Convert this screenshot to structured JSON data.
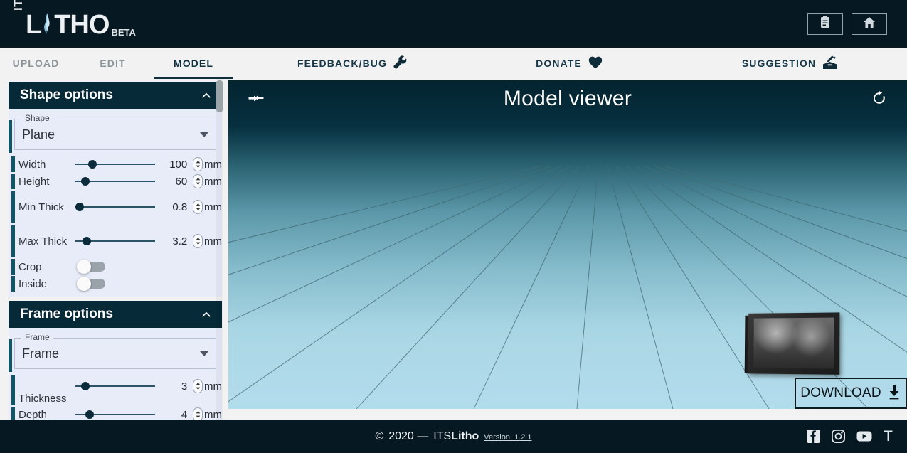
{
  "topbar": {
    "logo": {
      "its": "ITS",
      "main_pre": "L",
      "main_post": "THO",
      "beta": "BETA"
    },
    "buttons": [
      {
        "name": "assignment",
        "icon": "clipboard-icon"
      },
      {
        "name": "home",
        "icon": "home-icon"
      }
    ]
  },
  "tabs": [
    {
      "label": "UPLOAD",
      "active": false
    },
    {
      "label": "EDIT",
      "active": false
    },
    {
      "label": "MODEL",
      "active": true
    }
  ],
  "links": [
    {
      "label": "FEEDBACK/BUG",
      "icon": "wrench-icon"
    },
    {
      "label": "DONATE",
      "icon": "heart-icon"
    },
    {
      "label": "SUGGESTION",
      "icon": "ballot-box-icon"
    }
  ],
  "sidebar": {
    "shape_panel": {
      "title": "Shape options",
      "select": {
        "legend": "Shape",
        "value": "Plane"
      },
      "controls": [
        {
          "label": "Width",
          "value": "100",
          "unit": "mm",
          "type": "slider",
          "fill": 0.2
        },
        {
          "label": "Height",
          "value": "60",
          "unit": "mm",
          "type": "slider",
          "fill": 0.12
        },
        {
          "label": "Min Thick",
          "value": "0.8",
          "unit": "mm",
          "type": "slider",
          "fill": 0.02
        },
        {
          "label": "Max Thick",
          "value": "3.2",
          "unit": "mm",
          "type": "slider",
          "fill": 0.12
        },
        {
          "label": "Crop",
          "value": "off",
          "type": "toggle"
        },
        {
          "label": "Inside",
          "value": "off",
          "type": "toggle"
        }
      ]
    },
    "frame_panel": {
      "title": "Frame options",
      "select": {
        "legend": "Frame",
        "value": "Frame"
      },
      "controls": [
        {
          "label": "Thickness",
          "value": "3",
          "unit": "mm",
          "type": "slider",
          "fill": 0.1
        },
        {
          "label": "Depth",
          "value": "4",
          "unit": "mm",
          "type": "slider",
          "fill": 0.16
        }
      ]
    }
  },
  "viewer": {
    "title": "Model viewer",
    "collapse_icon": "collapse-horizontal-icon",
    "refresh_icon": "refresh-icon",
    "download_label": "DOWNLOAD",
    "download_icon": "download-icon"
  },
  "footer": {
    "copyright_symbol": "©",
    "year_dash": "2020 —",
    "brand_pre": "ITS",
    "brand_post": "Litho",
    "version": "Version: 1.2.1",
    "social": [
      {
        "name": "facebook",
        "icon": "facebook-icon"
      },
      {
        "name": "instagram",
        "icon": "instagram-icon"
      },
      {
        "name": "youtube",
        "icon": "youtube-icon"
      },
      {
        "name": "thingiverse",
        "icon": "thingiverse-icon",
        "glyph": "T"
      }
    ]
  },
  "colors": {
    "dark": "#061821",
    "panel_header": "#062a38",
    "accent_teal": "#115566",
    "panel_bg": "#e7ecf8",
    "page_bg": "#f2f2f2"
  }
}
